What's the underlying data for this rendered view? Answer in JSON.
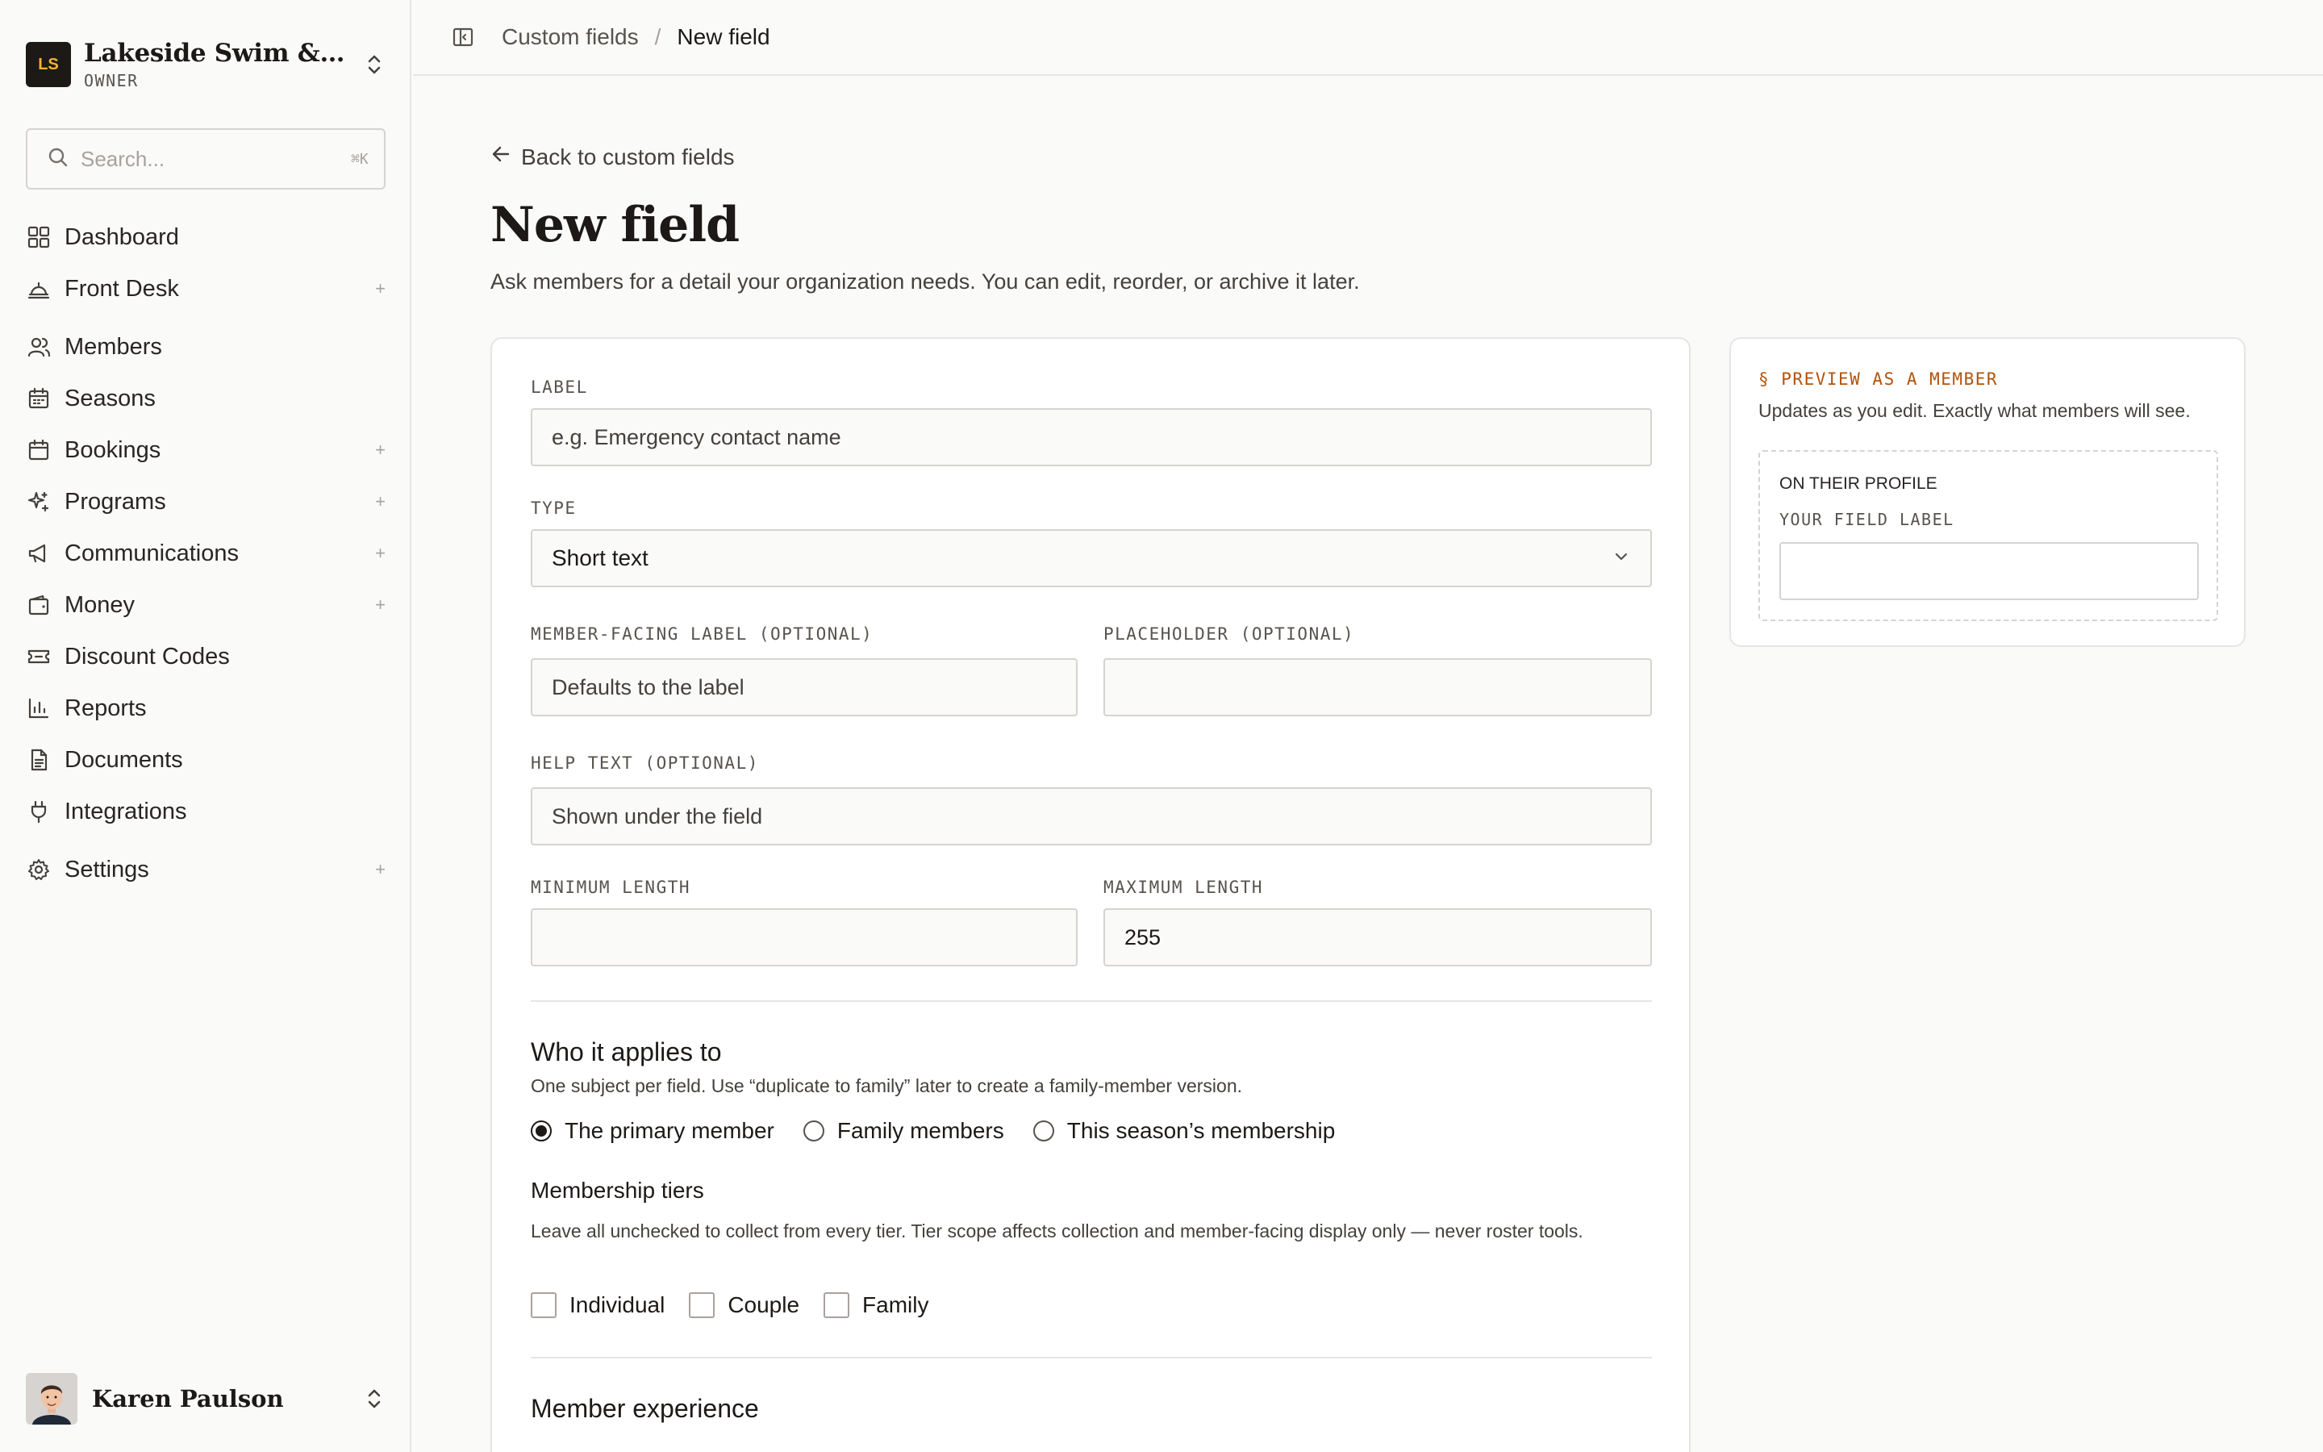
{
  "org": {
    "initials": "LS",
    "name": "Lakeside Swim & Tennis Club",
    "role": "OWNER"
  },
  "search": {
    "placeholder": "Search...",
    "shortcut": "⌘K"
  },
  "nav": [
    {
      "label": "Dashboard",
      "icon": "dashboard-icon",
      "expandable": false
    },
    {
      "label": "Front Desk",
      "icon": "bell-icon",
      "expandable": true
    },
    {
      "label": "Members",
      "icon": "users-icon",
      "expandable": false
    },
    {
      "label": "Seasons",
      "icon": "calendar-icon",
      "expandable": false
    },
    {
      "label": "Bookings",
      "icon": "calendar-check-icon",
      "expandable": true
    },
    {
      "label": "Programs",
      "icon": "sparkles-icon",
      "expandable": true
    },
    {
      "label": "Communications",
      "icon": "megaphone-icon",
      "expandable": true
    },
    {
      "label": "Money",
      "icon": "wallet-icon",
      "expandable": true
    },
    {
      "label": "Discount Codes",
      "icon": "ticket-icon",
      "expandable": false
    },
    {
      "label": "Reports",
      "icon": "bar-chart-icon",
      "expandable": false
    },
    {
      "label": "Documents",
      "icon": "document-icon",
      "expandable": false
    },
    {
      "label": "Integrations",
      "icon": "plug-icon",
      "expandable": false
    },
    {
      "label": "Settings",
      "icon": "gear-icon",
      "expandable": true
    }
  ],
  "user": {
    "name": "Karen Paulson"
  },
  "breadcrumb": {
    "parent": "Custom fields",
    "separator": "/",
    "current": "New field"
  },
  "page": {
    "back_label": "Back to custom fields",
    "title": "New field",
    "subtitle": "Ask members for a detail your organization needs. You can edit, reorder, or archive it later."
  },
  "form": {
    "label": {
      "label": "LABEL",
      "placeholder": "e.g. Emergency contact name"
    },
    "type": {
      "label": "TYPE",
      "value": "Short text"
    },
    "member_label": {
      "label": "MEMBER-FACING LABEL (OPTIONAL)",
      "placeholder": "Defaults to the label"
    },
    "placeholder": {
      "label": "PLACEHOLDER (OPTIONAL)",
      "placeholder": ""
    },
    "help_text": {
      "label": "HELP TEXT (OPTIONAL)",
      "placeholder": "Shown under the field"
    },
    "min_length": {
      "label": "MINIMUM LENGTH",
      "value": ""
    },
    "max_length": {
      "label": "MAXIMUM LENGTH",
      "value": "255"
    },
    "applies": {
      "heading": "Who it applies to",
      "note": "One subject per field. Use “duplicate to family” later to create a family-member version.",
      "options": [
        "The primary member",
        "Family members",
        "This season’s membership"
      ],
      "selected": 0
    },
    "tiers": {
      "heading": "Membership tiers",
      "note": "Leave all unchecked to collect from every tier. Tier scope affects collection and member-facing display only — never roster tools.",
      "options": [
        "Individual",
        "Couple",
        "Family"
      ]
    },
    "experience": {
      "heading": "Member experience"
    }
  },
  "preview": {
    "title": "§ PREVIEW AS A MEMBER",
    "subtitle": "Updates as you edit. Exactly what members will see.",
    "section": "ON THEIR PROFILE",
    "field_label": "YOUR FIELD LABEL"
  },
  "colors": {
    "accent": "#b45309",
    "logo_bg": "#1c1917",
    "logo_fg": "#f5b335"
  }
}
